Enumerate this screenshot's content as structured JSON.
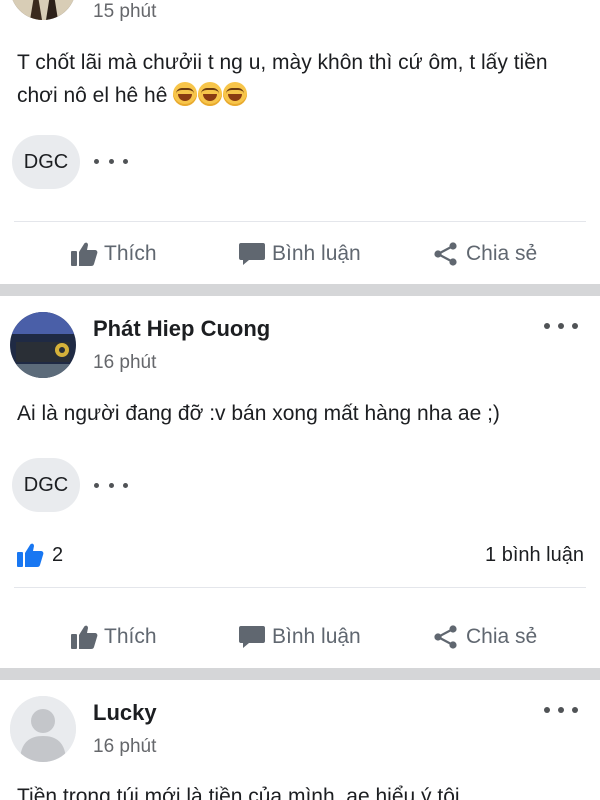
{
  "feed": {
    "posts": [
      {
        "time": "15 phút",
        "text": "T chốt lãi mà chưởii t ng u, mày khôn thì cứ ôm, t lấy tiền chơi nô el hê hê",
        "emoji_count": 3,
        "chip_label": "DGC"
      },
      {
        "author": "Phát Hiep Cuong",
        "time": "16 phút",
        "text": "Ai là người đang đỡ :v bán xong mất hàng nha ae ;)",
        "chip_label": "DGC",
        "like_count": "2",
        "comment_count": "1 bình luận"
      },
      {
        "author": "Lucky",
        "time": "16 phút",
        "text": "Tiền trong túi mới là tiền của mình, ae hiểu ý tôi"
      }
    ]
  },
  "actions": {
    "like_label": "Thích",
    "comment_label": "Bình luận",
    "share_label": "Chia sẻ"
  },
  "colors": {
    "like_blue": "#1877f2",
    "separator": "#d5d6d8",
    "muted_text": "#65676b"
  },
  "icons": [
    "thumbs-up-icon",
    "comment-bubble-icon",
    "share-icon",
    "more-dots-icon",
    "rofl-emoji-icon"
  ]
}
